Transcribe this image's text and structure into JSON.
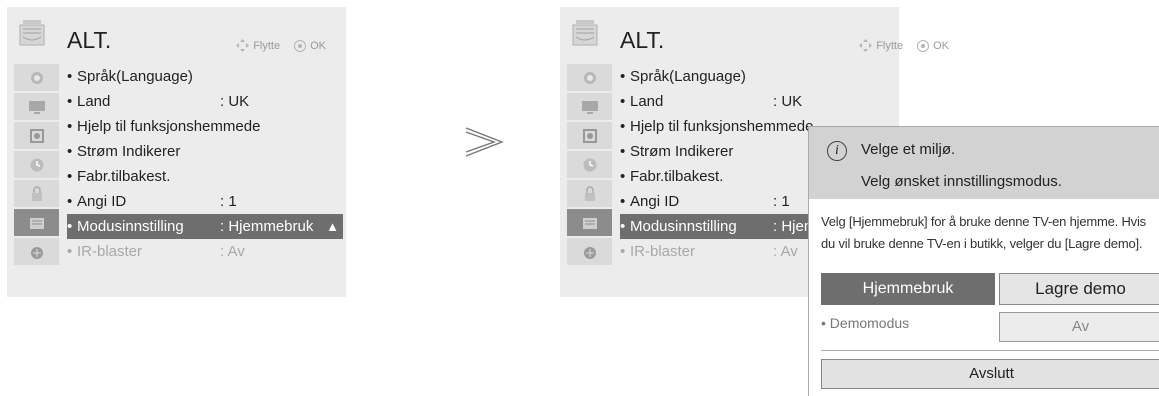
{
  "left_menu": {
    "title": "ALT.",
    "hint_move": "Flytte",
    "hint_ok": "OK",
    "items": [
      {
        "label": "Språk(Language)",
        "value": ""
      },
      {
        "label": "Land",
        "value": ": UK"
      },
      {
        "label": "Hjelp til funksjonshemmede",
        "value": ""
      },
      {
        "label": "Strøm Indikerer",
        "value": ""
      },
      {
        "label": "Fabr.tilbakest.",
        "value": ""
      },
      {
        "label": "Angi ID",
        "value": ": 1"
      },
      {
        "label": "Modusinnstilling",
        "value": ": Hjemmebruk",
        "selected": true
      },
      {
        "label": "IR-blaster",
        "value": ": Av",
        "disabled": true
      }
    ]
  },
  "right_menu": {
    "title": "ALT.",
    "hint_move": "Flytte",
    "hint_ok": "OK",
    "items": [
      {
        "label": "Språk(Language)",
        "value": ""
      },
      {
        "label": "Land",
        "value": ": UK"
      },
      {
        "label": "Hjelp til funksjonshemmede",
        "value": ""
      },
      {
        "label": "Strøm Indikerer",
        "value": ""
      },
      {
        "label": "Fabr.tilbakest.",
        "value": ""
      },
      {
        "label": "Angi ID",
        "value": ": 1"
      },
      {
        "label": "Modusinnstilling",
        "value": ": Hjem",
        "selected": true
      },
      {
        "label": "IR-blaster",
        "value": ": Av",
        "disabled": true
      }
    ]
  },
  "sidebar_icons": [
    "picture-icon",
    "monitor-icon",
    "audio-icon",
    "clock-icon",
    "lock-icon",
    "option-icon",
    "network-icon",
    "input-icon"
  ],
  "dialog": {
    "title": "Velge et miljø.",
    "subtitle": "Velg ønsket innstillingsmodus.",
    "description": "Velg [Hjemmebruk] for å bruke denne TV-en hjemme. Hvis du vil bruke denne TV-en i butikk, velger du [Lagre demo].",
    "option_home": "Hjemmebruk",
    "option_demo": "Lagre demo",
    "demo_mode_label": "• Demomodus",
    "demo_mode_value": "Av",
    "exit_label": "Avslutt"
  },
  "colors": {
    "selected_row": "#6e6e6e",
    "panel_bg": "#ececec",
    "dialog_header": "#d2d2d2"
  }
}
